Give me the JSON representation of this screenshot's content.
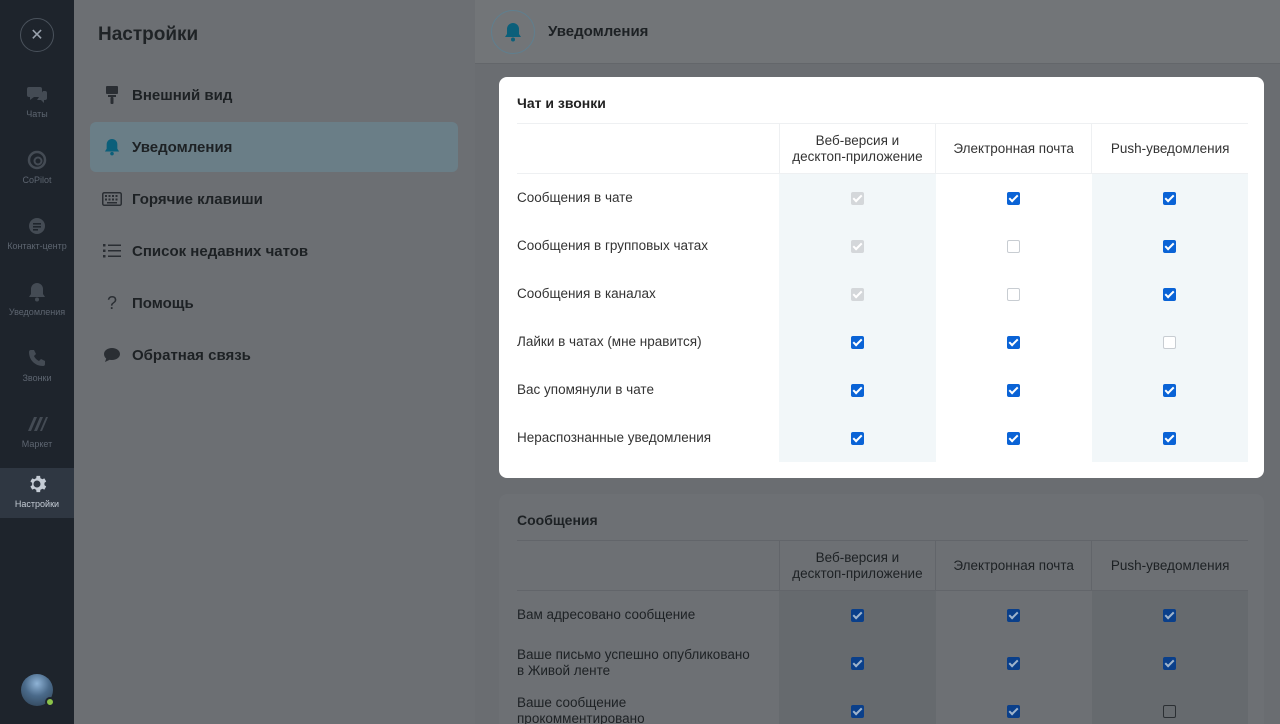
{
  "rail": {
    "items": [
      {
        "label": "Чаты",
        "icon": "chats-icon"
      },
      {
        "label": "CoPilot",
        "icon": "copilot-icon"
      },
      {
        "label": "Контакт-центр",
        "icon": "contact-center-icon"
      },
      {
        "label": "Уведомления",
        "icon": "bell-icon"
      },
      {
        "label": "Звонки",
        "icon": "phone-icon"
      },
      {
        "label": "Маркет",
        "icon": "market-icon"
      },
      {
        "label": "Настройки",
        "icon": "gear-icon"
      }
    ]
  },
  "sidebar": {
    "title": "Настройки",
    "items": [
      {
        "label": "Внешний вид",
        "icon": "brush-icon"
      },
      {
        "label": "Уведомления",
        "icon": "bell-icon"
      },
      {
        "label": "Горячие клавиши",
        "icon": "keyboard-icon"
      },
      {
        "label": "Список недавних чатов",
        "icon": "list-icon"
      },
      {
        "label": "Помощь",
        "icon": "question-icon"
      },
      {
        "label": "Обратная связь",
        "icon": "chat-bubble-icon"
      }
    ]
  },
  "main": {
    "title": "Уведомления"
  },
  "columns": {
    "web": "Веб-версия и\nдесктоп-приложение",
    "web_line1": "Веб-версия и",
    "web_line2": "десктоп-приложение",
    "email": "Электронная почта",
    "push": "Push-уведомления"
  },
  "chat_section": {
    "title": "Чат и звонки",
    "rows": [
      {
        "label": "Сообщения в чате",
        "web": "disabled-checked",
        "email": "checked",
        "push": "checked"
      },
      {
        "label": "Сообщения в групповых чатах",
        "web": "disabled-checked",
        "email": "unchecked",
        "push": "checked"
      },
      {
        "label": "Сообщения в каналах",
        "web": "disabled-checked",
        "email": "unchecked",
        "push": "checked"
      },
      {
        "label": "Лайки в чатах (мне нравится)",
        "web": "checked",
        "email": "checked",
        "push": "unchecked"
      },
      {
        "label": "Вас упомянули в чате",
        "web": "checked",
        "email": "checked",
        "push": "checked"
      },
      {
        "label": "Нераспознанные уведомления",
        "web": "checked",
        "email": "checked",
        "push": "checked"
      }
    ]
  },
  "messages_section": {
    "title": "Сообщения",
    "rows": [
      {
        "label_line1": "Вам адресовано сообщение",
        "label_line2": "",
        "web": "checked",
        "email": "checked",
        "push": "checked"
      },
      {
        "label_line1": "Ваше письмо успешно опубликовано",
        "label_line2": "в Живой ленте",
        "web": "checked",
        "email": "checked",
        "push": "checked"
      },
      {
        "label_line1": "Ваше сообщение",
        "label_line2": "прокомментировано",
        "web": "checked",
        "email": "checked",
        "push": "unchecked"
      }
    ]
  },
  "colors": {
    "accent": "#0a63d6",
    "rail_bg": "#1e242c",
    "active_item": "#6a7e87"
  }
}
